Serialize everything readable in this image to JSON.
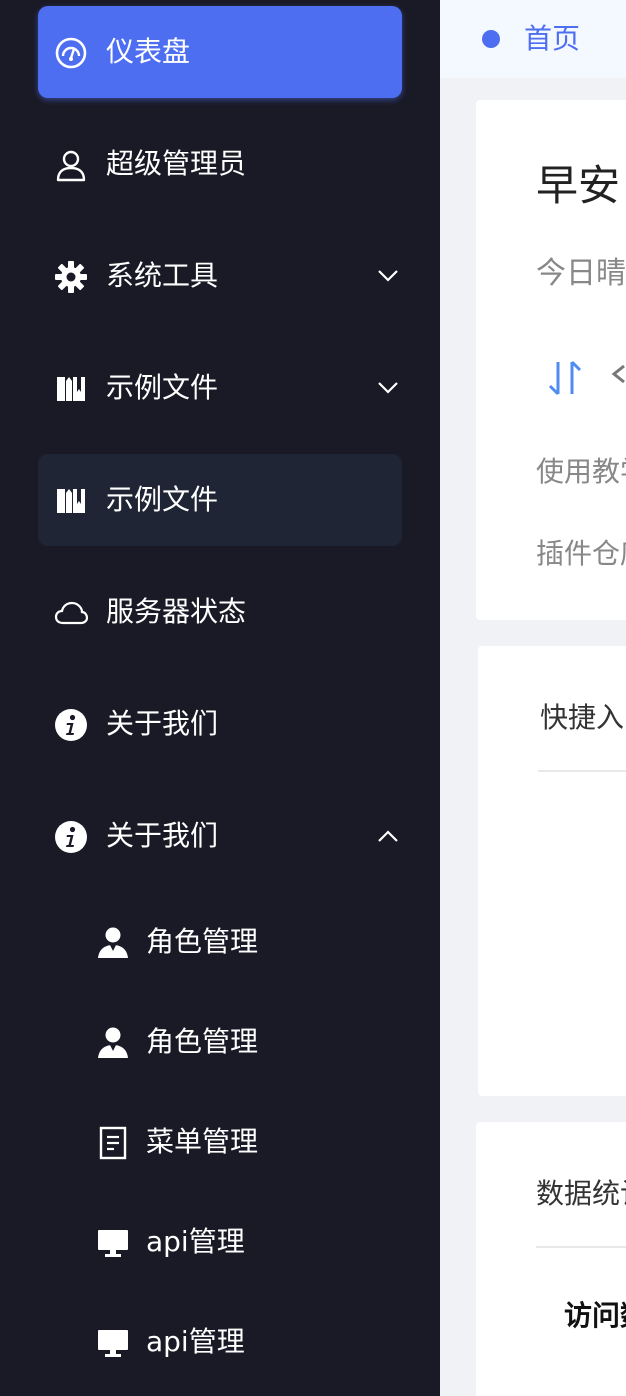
{
  "sidebar": {
    "items": [
      {
        "label": "仪表盘",
        "icon": "dashboard-icon",
        "state": "active"
      },
      {
        "label": "超级管理员",
        "icon": "user-icon"
      },
      {
        "label": "系统工具",
        "icon": "gear-icon",
        "chevron": "down"
      },
      {
        "label": "示例文件",
        "icon": "folder-icon",
        "chevron": "down"
      },
      {
        "label": "示例文件",
        "icon": "folder-icon",
        "state": "selected"
      },
      {
        "label": "服务器状态",
        "icon": "cloud-icon"
      },
      {
        "label": "关于我们",
        "icon": "info-icon"
      },
      {
        "label": "关于我们",
        "icon": "info-icon",
        "chevron": "up"
      }
    ],
    "sub_items": [
      {
        "label": "角色管理",
        "icon": "person-icon"
      },
      {
        "label": "角色管理",
        "icon": "person-icon"
      },
      {
        "label": "菜单管理",
        "icon": "document-icon"
      },
      {
        "label": "api管理",
        "icon": "monitor-icon"
      },
      {
        "label": "api管理",
        "icon": "monitor-icon"
      }
    ]
  },
  "tabs": {
    "home_label": "首页"
  },
  "welcome_card": {
    "greeting": "早安",
    "weather": "今日晴",
    "tutorial_link": "使用教学",
    "plugin_link": "插件仓库"
  },
  "shortcut_card": {
    "title": "快捷入口"
  },
  "stats_card": {
    "title": "数据统计",
    "visit_label": "访问数"
  },
  "colors": {
    "sidebar_bg": "#1a1a26",
    "accent": "#4e6ef2",
    "selected_bg": "#1f2535"
  }
}
